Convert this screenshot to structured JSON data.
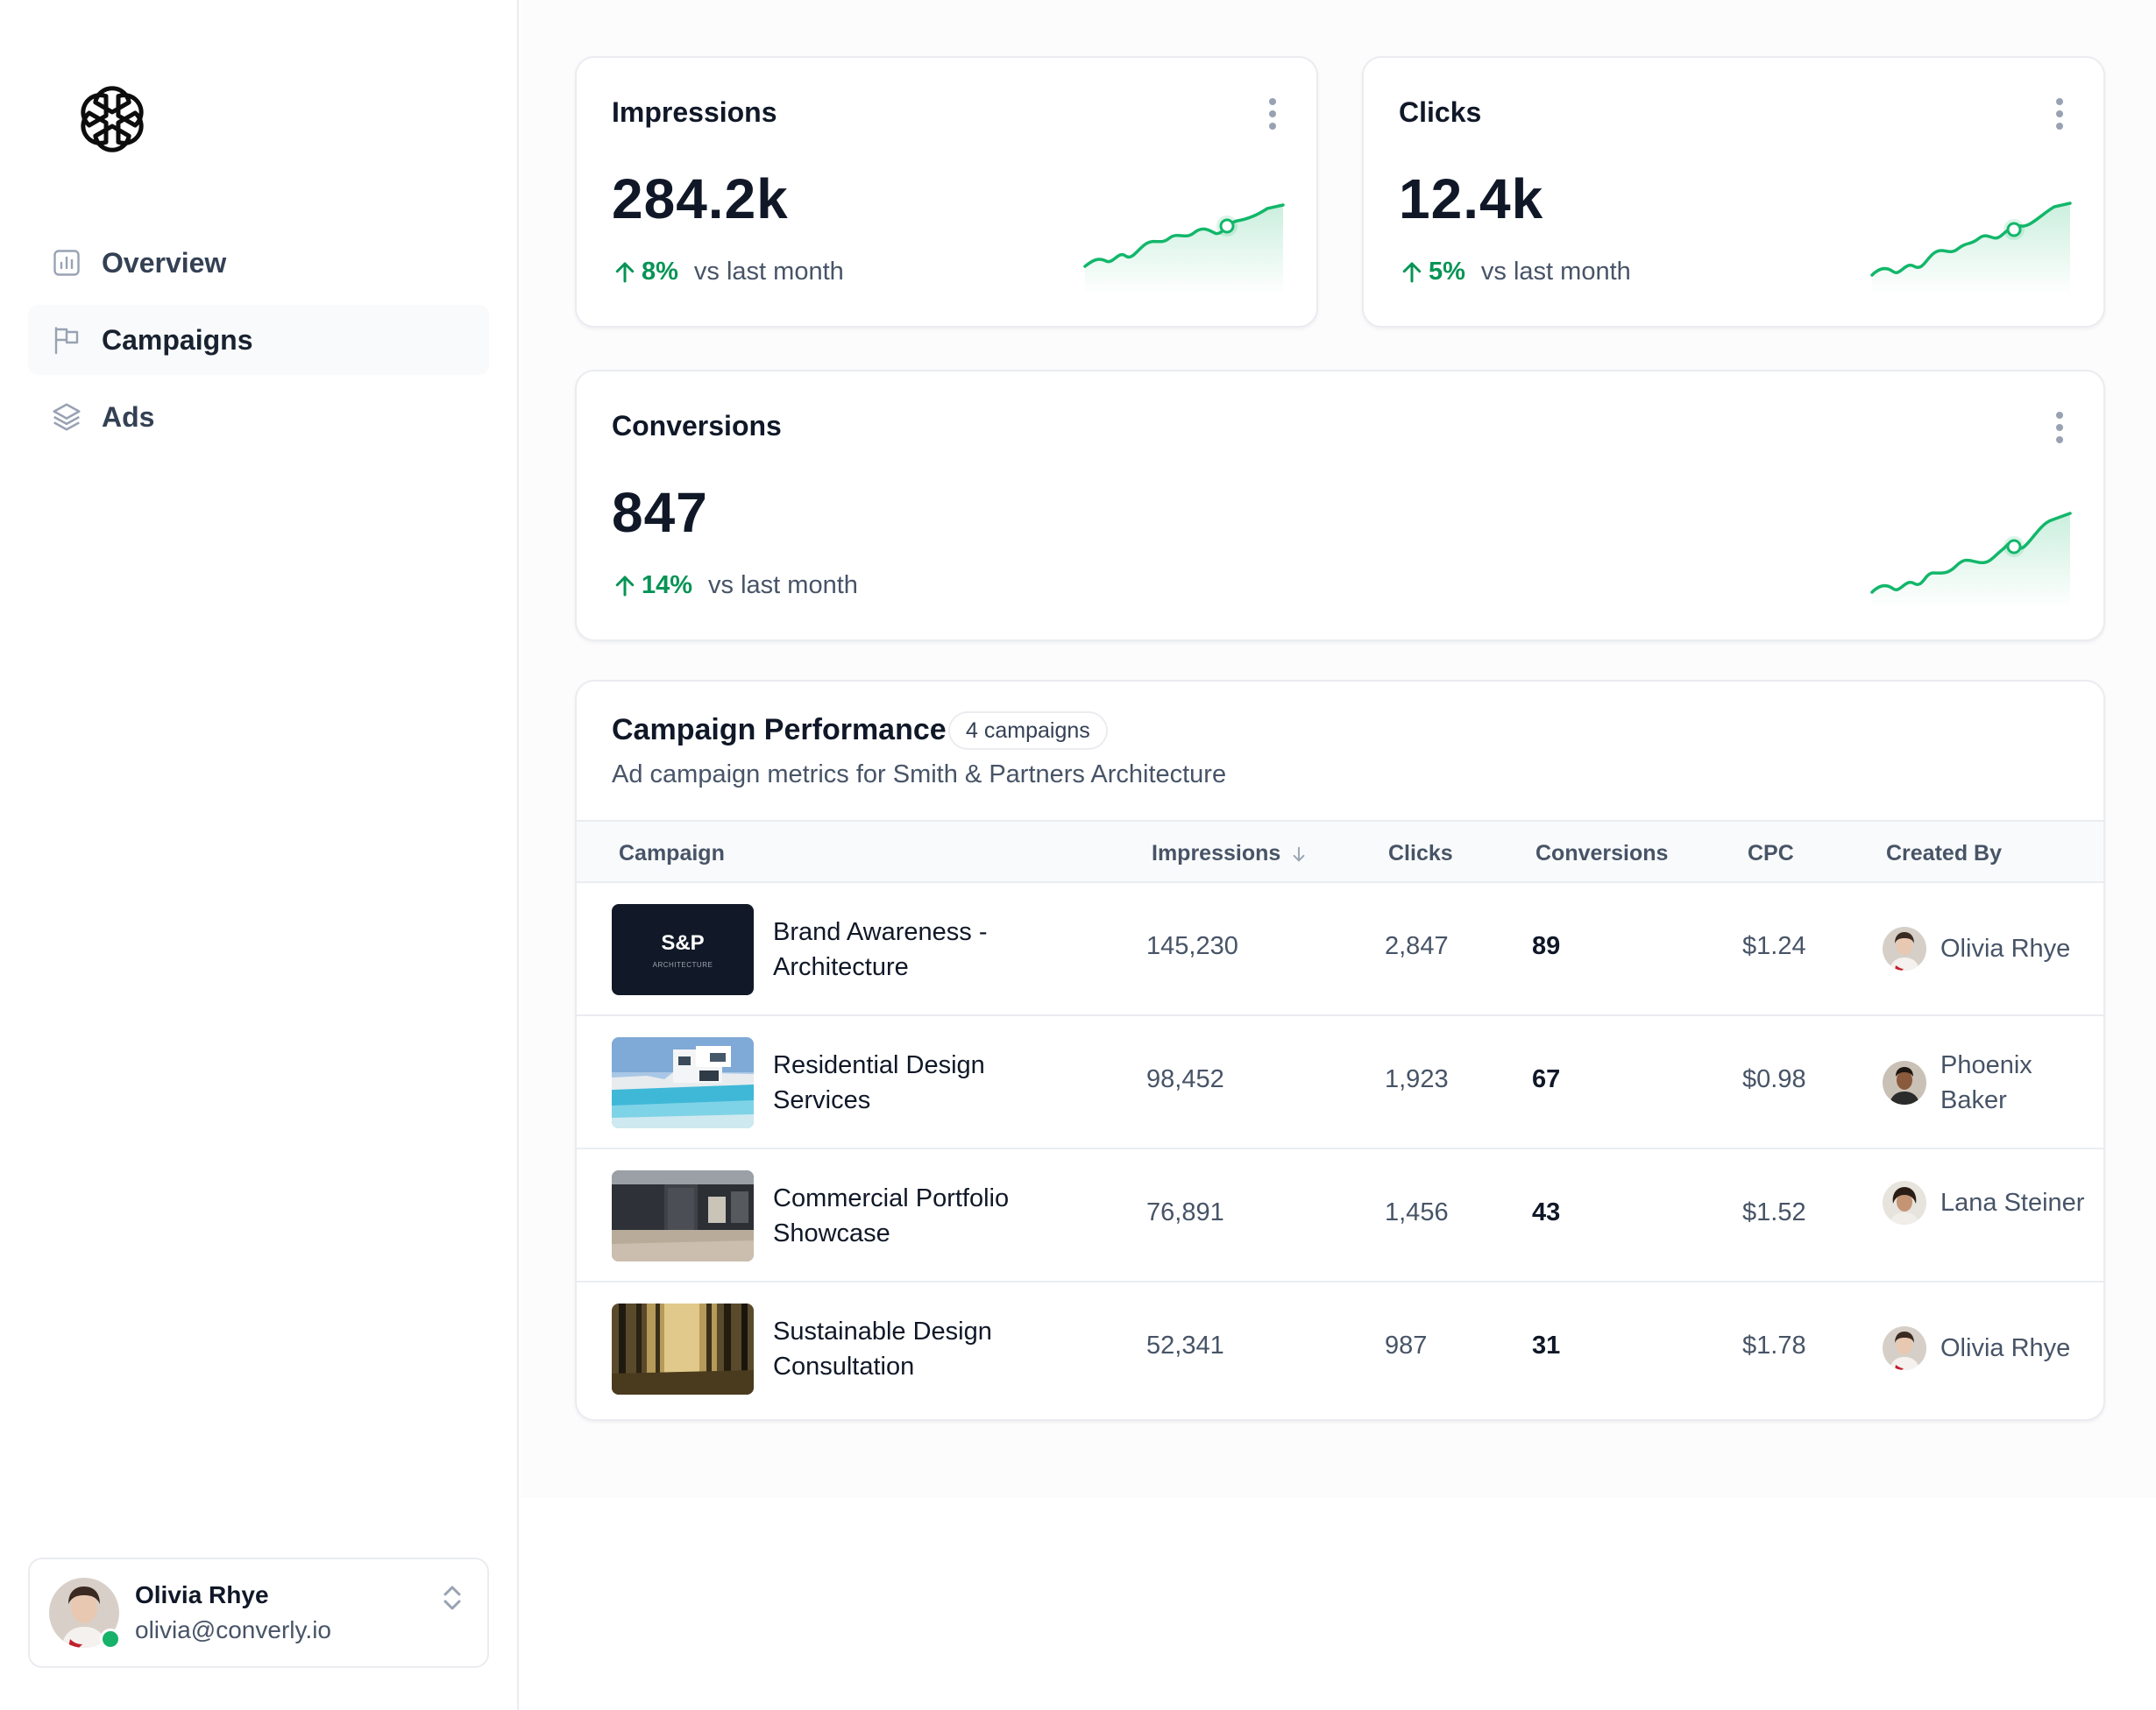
{
  "sidebar": {
    "logo": "openai-knot-icon",
    "items": [
      {
        "label": "Overview",
        "icon": "bar-chart-square-icon",
        "active": false
      },
      {
        "label": "Campaigns",
        "icon": "flag-icon",
        "active": true
      },
      {
        "label": "Ads",
        "icon": "layers-icon",
        "active": false
      }
    ],
    "user": {
      "name": "Olivia Rhye",
      "email": "olivia@converly.io",
      "status": "online"
    }
  },
  "metrics": [
    {
      "title": "Impressions",
      "value": "284.2k",
      "change": "8%",
      "comparison": "vs last month",
      "trend": "up"
    },
    {
      "title": "Clicks",
      "value": "12.4k",
      "change": "5%",
      "comparison": "vs last month",
      "trend": "up"
    },
    {
      "title": "Conversions",
      "value": "847",
      "change": "14%",
      "comparison": "vs last month",
      "trend": "up"
    }
  ],
  "campaign_table": {
    "title": "Campaign Performance",
    "badge": "4 campaigns",
    "subtitle": "Ad campaign metrics for Smith & Partners Architecture",
    "columns": [
      "Campaign",
      "Impressions",
      "Clicks",
      "Conversions",
      "CPC",
      "Created By"
    ],
    "sort_column": "Impressions",
    "sort_direction": "descending",
    "rows": [
      {
        "name": "Brand Awareness - Architecture",
        "thumb_title": "S&P",
        "thumb_sub": "ARCHITECTURE",
        "impressions": "145,230",
        "clicks": "2,847",
        "conversions": "89",
        "cpc": "$1.24",
        "created_by": "Olivia Rhye"
      },
      {
        "name": "Residential Design Services",
        "impressions": "98,452",
        "clicks": "1,923",
        "conversions": "67",
        "cpc": "$0.98",
        "created_by": "Phoenix Baker"
      },
      {
        "name": "Commercial Portfolio Showcase",
        "impressions": "76,891",
        "clicks": "1,456",
        "conversions": "43",
        "cpc": "$1.52",
        "created_by": "Lana Steiner"
      },
      {
        "name": "Sustainable Design Consultation",
        "impressions": "52,341",
        "clicks": "987",
        "conversions": "31",
        "cpc": "$1.78",
        "created_by": "Olivia Rhye"
      }
    ]
  },
  "colors": {
    "accent_green": "#079455",
    "spark_line": "#12b76a",
    "status_online": "#17b26a",
    "thumb_dark": "#111827"
  }
}
